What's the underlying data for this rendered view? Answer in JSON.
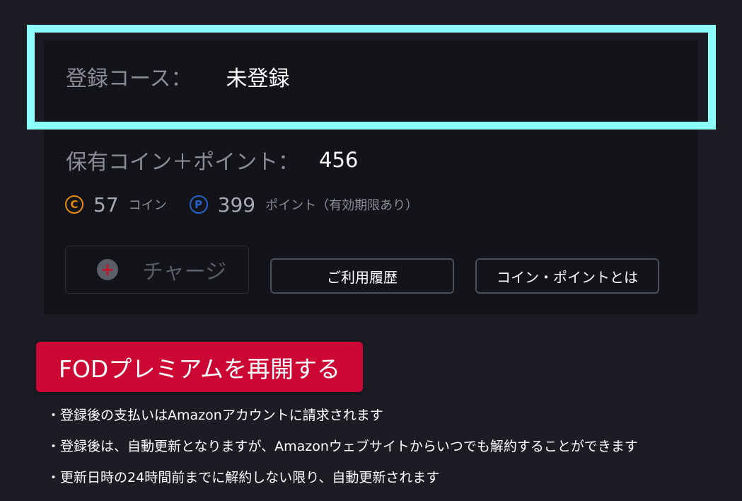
{
  "subscription": {
    "label": "登録コース：",
    "value": "未登録"
  },
  "balance": {
    "label": "保有コイン＋ポイント：",
    "total": "456",
    "coin_symbol": "C",
    "coins": "57",
    "coin_unit": "コイン",
    "point_symbol": "P",
    "points": "399",
    "point_unit": "ポイント（有効期限あり）"
  },
  "buttons": {
    "charge": "チャージ",
    "charge_icon": "plus-icon",
    "history": "ご利用履歴",
    "about": "コイン・ポイントとは",
    "resume": "FODプレミアムを再開する"
  },
  "notes": [
    "登録後の支払いはAmazonアカウントに請求されます",
    "登録後は、自動更新となりますが、Amazonウェブサイトからいつでも解約することができます",
    "更新日時の24時間前までに解約しない限り、自動更新されます"
  ],
  "colors": {
    "background": "#1c1d24",
    "panel": "#12141a",
    "highlight": "#8cfffa",
    "primary": "#cc0734",
    "coin": "#e98a0b",
    "point": "#2a62c9"
  }
}
